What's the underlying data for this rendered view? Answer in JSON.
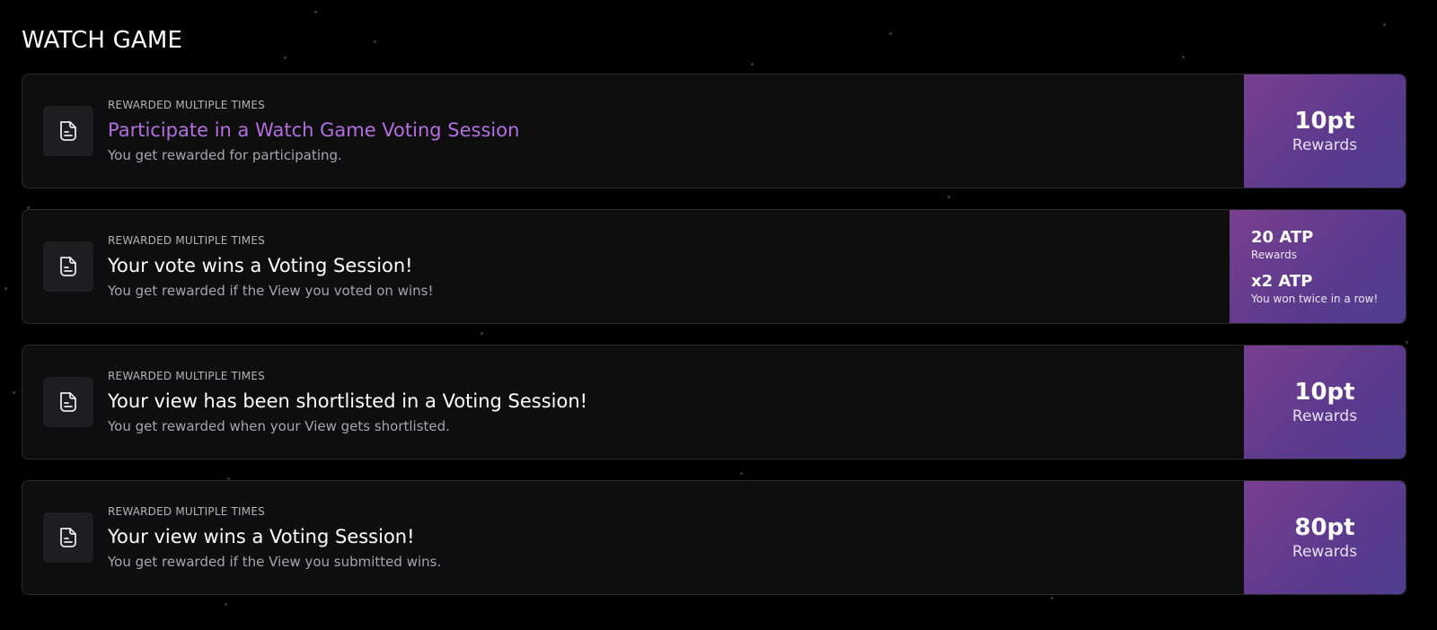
{
  "section": {
    "title": "WATCH GAME"
  },
  "icon": "document-icon",
  "colors": {
    "accent_title": "#b36ee0",
    "reward_gradient_start": "#7a3f8f",
    "reward_gradient_end": "#4f3d8f"
  },
  "cards": [
    {
      "eyebrow": "REWARDED MULTIPLE TIMES",
      "title": "Participate in a Watch Game Voting Session",
      "description": "You get rewarded for participating.",
      "reward": {
        "amount": "10pt",
        "label": "Rewards"
      }
    },
    {
      "eyebrow": "REWARDED MULTIPLE TIMES",
      "title": "Your vote wins a Voting Session!",
      "description": "You get rewarded if the View you voted on wins!",
      "reward": {
        "amount": "20 ATP",
        "label": "Rewards",
        "bonus_amount": "x2 ATP",
        "bonus_label": "You won twice in a row!"
      }
    },
    {
      "eyebrow": "REWARDED MULTIPLE TIMES",
      "title": "Your view has been shortlisted in a Voting Session!",
      "description": "You get rewarded when your View gets shortlisted.",
      "reward": {
        "amount": "10pt",
        "label": "Rewards"
      }
    },
    {
      "eyebrow": "REWARDED MULTIPLE TIMES",
      "title": "Your view wins a Voting Session!",
      "description": "You get rewarded if the View you submitted wins.",
      "reward": {
        "amount": "80pt",
        "label": "Rewards"
      }
    }
  ]
}
